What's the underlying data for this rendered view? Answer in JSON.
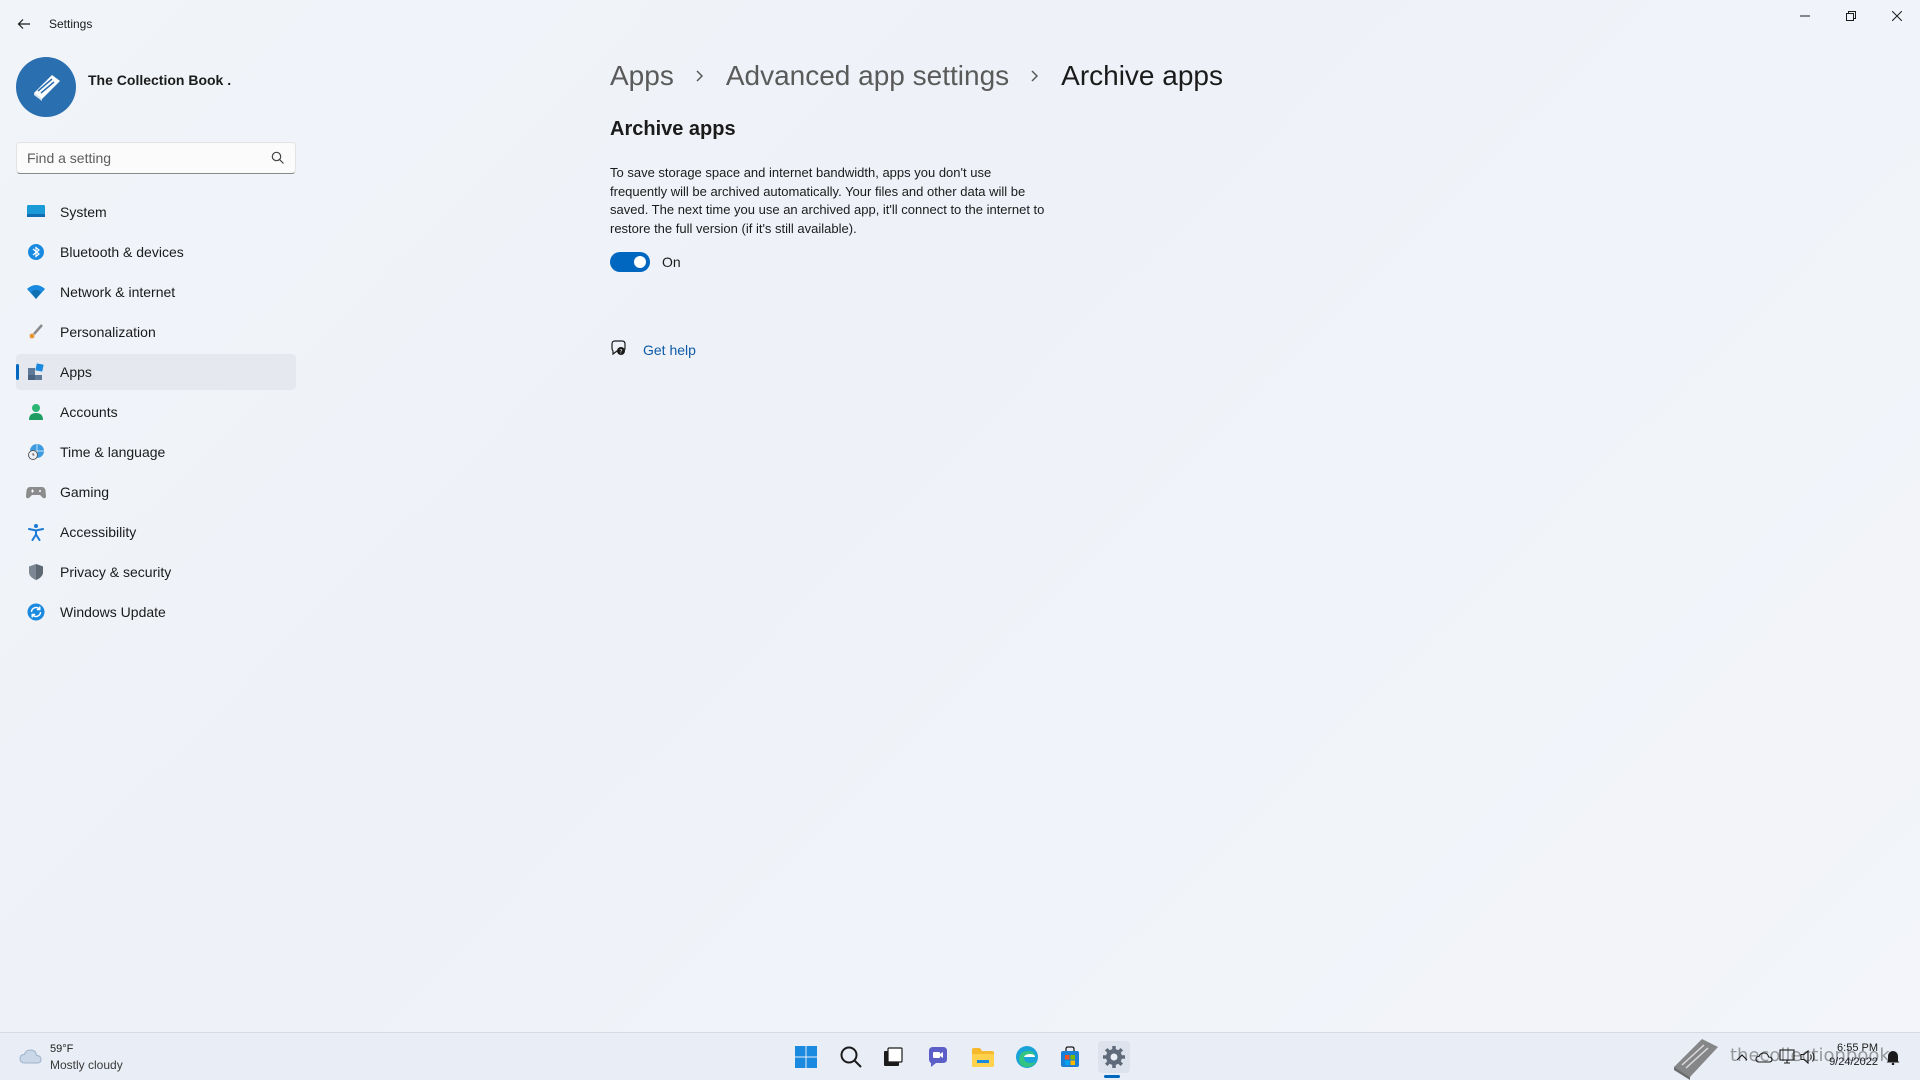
{
  "window": {
    "title": "Settings",
    "controls": {
      "minimize": "minimize-icon",
      "restore": "restore-icon",
      "close": "close-icon"
    }
  },
  "profile": {
    "name": "The Collection Book ."
  },
  "search": {
    "placeholder": "Find a setting"
  },
  "sidebar": {
    "items": [
      {
        "label": "System",
        "icon": "system-display-icon"
      },
      {
        "label": "Bluetooth & devices",
        "icon": "bluetooth-icon"
      },
      {
        "label": "Network & internet",
        "icon": "wifi-icon"
      },
      {
        "label": "Personalization",
        "icon": "brush-icon"
      },
      {
        "label": "Apps",
        "icon": "apps-icon",
        "active": true
      },
      {
        "label": "Accounts",
        "icon": "person-icon"
      },
      {
        "label": "Time & language",
        "icon": "globe-clock-icon"
      },
      {
        "label": "Gaming",
        "icon": "gamepad-icon"
      },
      {
        "label": "Accessibility",
        "icon": "accessibility-icon"
      },
      {
        "label": "Privacy & security",
        "icon": "shield-icon"
      },
      {
        "label": "Windows Update",
        "icon": "update-icon"
      }
    ]
  },
  "breadcrumb": [
    "Apps",
    "Advanced app settings",
    "Archive apps"
  ],
  "content": {
    "section_title": "Archive apps",
    "description": "To save storage space and internet bandwidth, apps you don't use frequently will be archived automatically. Your files and other data will be saved. The next time you use an archived app, it'll connect to the internet to restore the full version (if it's still available).",
    "toggle_state": "On",
    "help_link": "Get help"
  },
  "taskbar": {
    "weather_temp": "59°F",
    "weather_desc": "Mostly cloudy",
    "time": "6:55 PM",
    "date": "9/24/2022",
    "watermark": "thecollectionbook"
  },
  "colors": {
    "accent": "#0067c0",
    "link": "#0e5aa8"
  }
}
